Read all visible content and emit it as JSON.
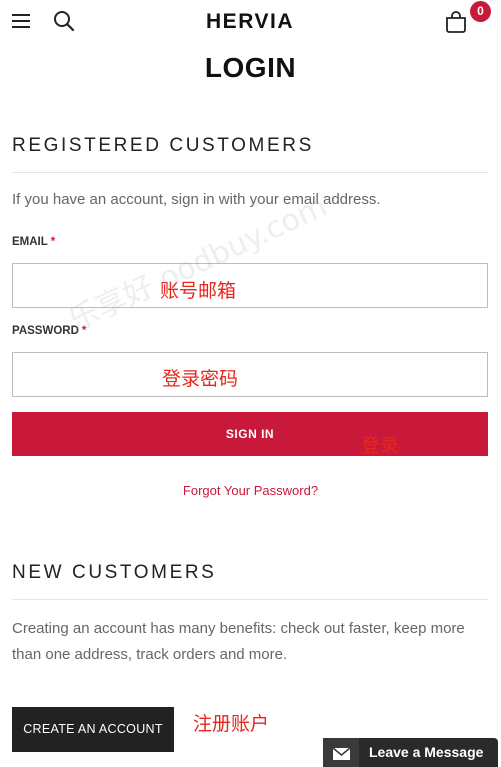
{
  "header": {
    "logo_text": "HERVIA",
    "cart_count": "0"
  },
  "page": {
    "title": "LOGIN"
  },
  "registered": {
    "heading": "REGISTERED CUSTOMERS",
    "intro": "If you have an account, sign in with your email address.",
    "email_label": "EMAIL",
    "password_label": "PASSWORD",
    "required_mark": "*",
    "signin_label": "SIGN IN",
    "forgot_label": "Forgot Your Password?"
  },
  "annotations": {
    "email": "账号邮箱",
    "password": "登录密码",
    "signin": "登录",
    "register": "注册账户"
  },
  "new_customers": {
    "heading": "NEW CUSTOMERS",
    "text": "Creating an account has many benefits: check out faster, keep more than one address, track orders and more.",
    "create_label": "CREATE AN ACCOUNT"
  },
  "chat": {
    "label": "Leave a Message"
  },
  "watermark": {
    "text": "乐享好    oodbuy.com"
  },
  "colors": {
    "accent": "#c8193a",
    "dark_button": "#222222",
    "annotation": "#e8271c"
  },
  "icons": [
    "menu-icon",
    "search-icon",
    "shopping-bag-icon",
    "envelope-icon"
  ]
}
